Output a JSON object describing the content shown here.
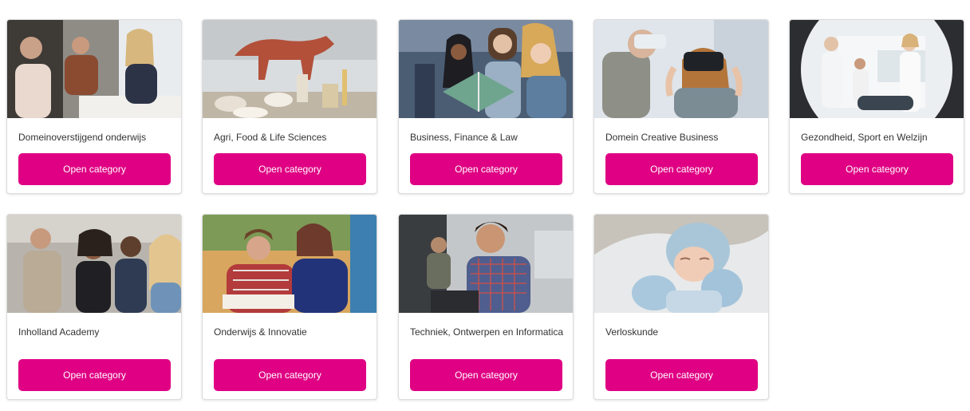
{
  "colors": {
    "button": "#df0083",
    "title_text": "#333333"
  },
  "categories": [
    {
      "title": "Domeinoverstijgend onderwijs",
      "button_label": "Open category",
      "image": "meeting-photo"
    },
    {
      "title": "Agri, Food & Life Sciences",
      "button_label": "Open category",
      "image": "lab-animal-model-photo"
    },
    {
      "title": "Business, Finance & Law",
      "button_label": "Open category",
      "image": "students-reading-photo"
    },
    {
      "title": "Domein Creative Business",
      "button_label": "Open category",
      "image": "vr-headset-photo"
    },
    {
      "title": "Gezondheid, Sport en Welzijn",
      "button_label": "Open category",
      "image": "medical-scanner-photo"
    },
    {
      "title": "Inholland Academy",
      "button_label": "Open category",
      "image": "classroom-adults-photo"
    },
    {
      "title": "Onderwijs & Innovatie",
      "button_label": "Open category",
      "image": "teacher-child-photo"
    },
    {
      "title": "Techniek, Ontwerpen en Informatica",
      "button_label": "Open category",
      "image": "student-laptop-photo"
    },
    {
      "title": "Verloskunde",
      "button_label": "Open category",
      "image": "newborn-baby-photo"
    }
  ]
}
